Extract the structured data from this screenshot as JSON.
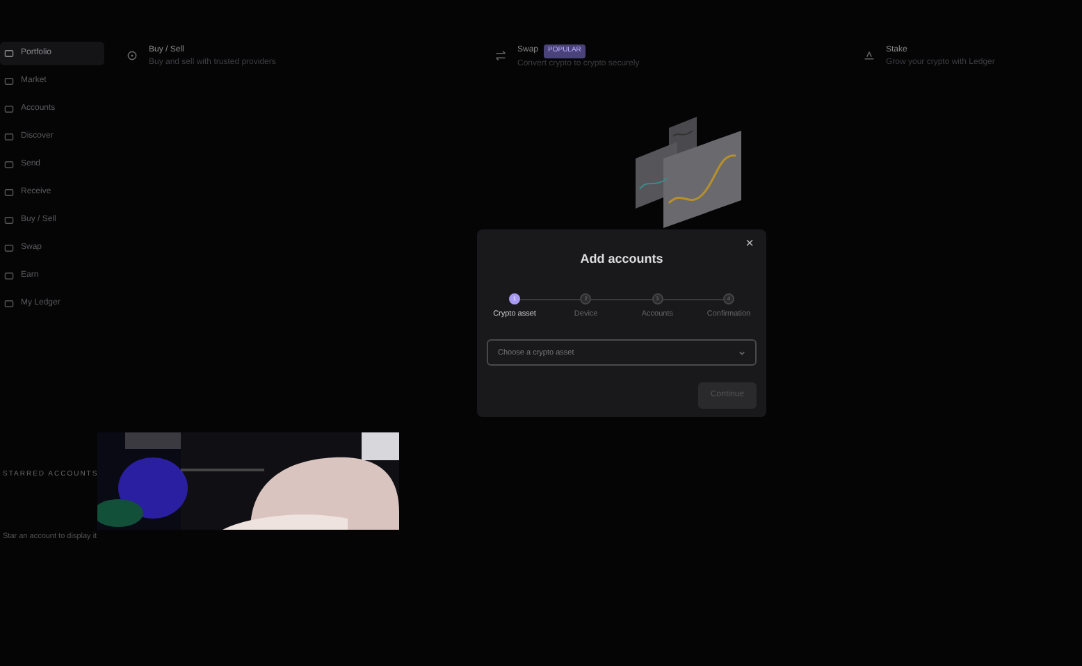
{
  "sidebar": {
    "items": [
      {
        "label": "Portfolio",
        "selected": true
      },
      {
        "label": "Market",
        "selected": false
      },
      {
        "label": "Accounts",
        "selected": false
      },
      {
        "label": "Discover",
        "selected": false
      },
      {
        "label": "Send",
        "selected": false
      },
      {
        "label": "Receive",
        "selected": false
      },
      {
        "label": "Buy / Sell",
        "selected": false
      },
      {
        "label": "Swap",
        "selected": false
      },
      {
        "label": "Earn",
        "selected": false
      },
      {
        "label": "My Ledger",
        "selected": false
      }
    ]
  },
  "starred": {
    "title": "STARRED ACCOUNTS",
    "empty_text": "Star an account to display it"
  },
  "actions": [
    {
      "kind": "buy",
      "title": "Buy / Sell",
      "subtitle": "Buy and sell with trusted providers"
    },
    {
      "kind": "swap",
      "title": "Swap",
      "badge": "POPULAR",
      "subtitle": "Convert crypto to crypto securely"
    },
    {
      "kind": "stake",
      "title": "Stake",
      "subtitle": "Grow your crypto with Ledger"
    }
  ],
  "modal": {
    "title": "Add accounts",
    "close": "×",
    "steps": [
      {
        "number": "1",
        "label": "Crypto asset",
        "selected": true
      },
      {
        "number": "2",
        "label": "Device",
        "selected": false
      },
      {
        "number": "3",
        "label": "Accounts",
        "selected": false
      },
      {
        "number": "4",
        "label": "Confirmation",
        "selected": false
      }
    ],
    "select": {
      "placeholder": "Choose a crypto asset"
    },
    "button": {
      "label": "Continue",
      "disabled": true
    }
  }
}
